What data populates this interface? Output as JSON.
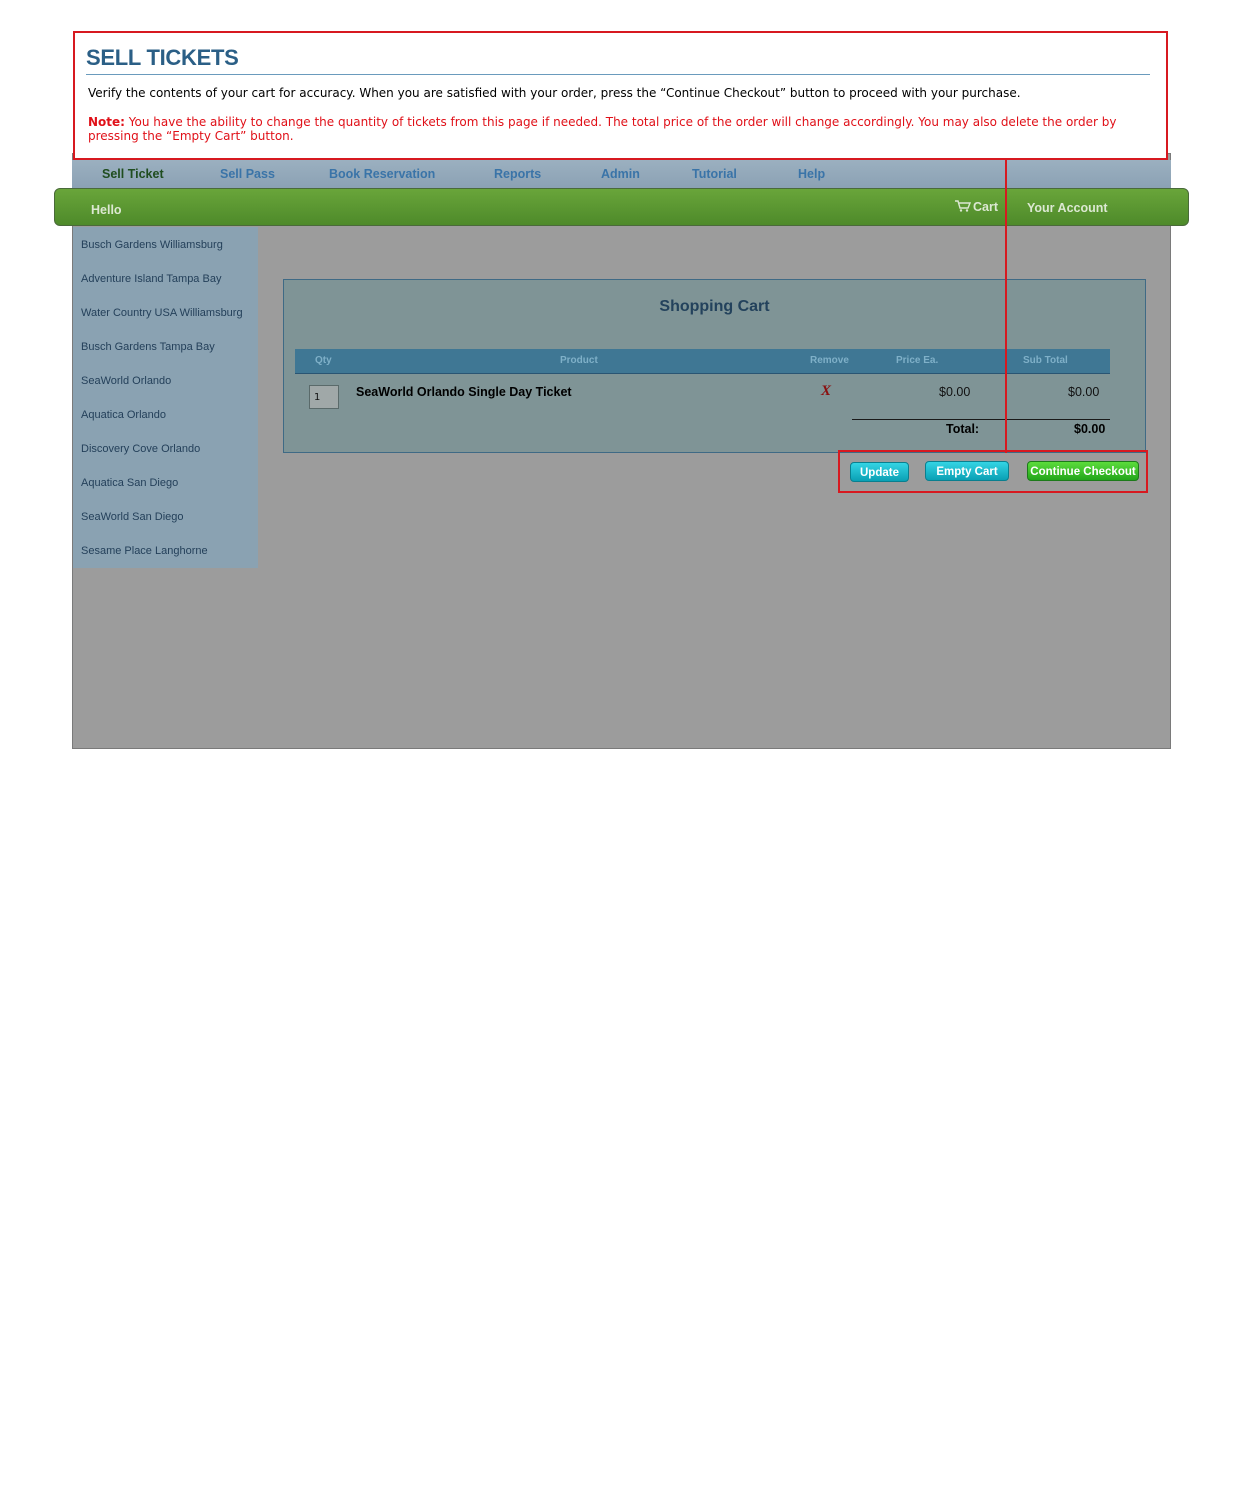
{
  "annotation": {
    "title": "SELL TICKETS",
    "instructions": "Verify the contents of your cart for accuracy. When you are satisfied with your order, press the “Continue Checkout” button to proceed with your purchase.",
    "note_label": "Note:",
    "note_text": " You have the ability to change the quantity of tickets from this page if needed. The total price of the order will change accordingly. You may also delete the order by pressing the “Empty Cart” button.",
    "accent_color": "#d71920"
  },
  "nav": {
    "items": [
      "Sell Ticket",
      "Sell Pass",
      "Book Reservation",
      "Reports",
      "Admin",
      "Tutorial",
      "Help"
    ],
    "active": "Sell Ticket"
  },
  "greenbar": {
    "hello": "Hello",
    "cart": "Cart",
    "account": "Your Account"
  },
  "sidebar": {
    "items": [
      "Busch Gardens Williamsburg",
      "Adventure Island Tampa Bay",
      "Water Country USA Williamsburg",
      "Busch Gardens Tampa Bay",
      "SeaWorld Orlando",
      "Aquatica Orlando",
      "Discovery Cove Orlando",
      "Aquatica San Diego",
      "SeaWorld San Diego",
      "Sesame Place Langhorne"
    ]
  },
  "cart": {
    "title": "Shopping Cart",
    "columns": {
      "qty": "Qty",
      "product": "Product",
      "remove": "Remove",
      "price": "Price Ea.",
      "subtotal": "Sub Total"
    },
    "row": {
      "qty": "1",
      "product": "SeaWorld Orlando Single Day Ticket",
      "remove_icon": "X",
      "price": "$0.00",
      "subtotal": "$0.00"
    },
    "total_label": "Total:",
    "total_value": "$0.00"
  },
  "buttons": {
    "update": "Update",
    "empty": "Empty Cart",
    "checkout": "Continue Checkout"
  }
}
